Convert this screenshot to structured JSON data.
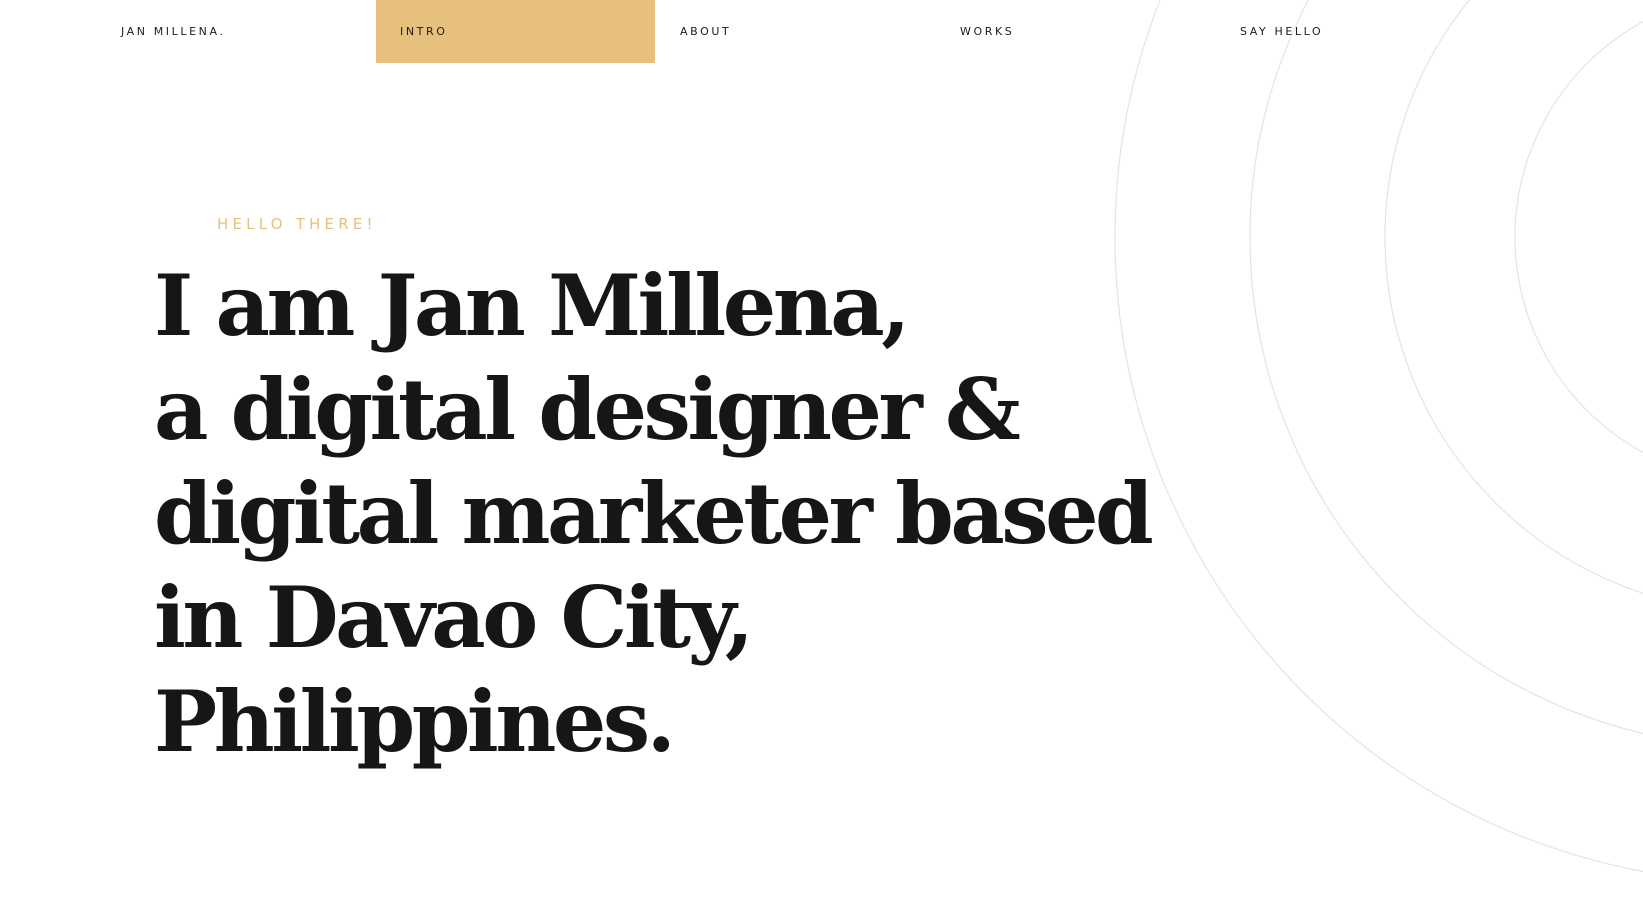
{
  "nav": {
    "brand": "JAN MILLENA.",
    "items": [
      {
        "label": "INTRO",
        "active": true
      },
      {
        "label": "ABOUT",
        "active": false
      },
      {
        "label": "WORKS",
        "active": false
      },
      {
        "label": "SAY HELLO",
        "active": false
      }
    ]
  },
  "hero": {
    "eyebrow": "HELLO THERE!",
    "headline_lines": [
      "I am Jan Millena,",
      "a digital designer &",
      "digital marketer based",
      "in Davao City,",
      "Philippines."
    ]
  },
  "colors": {
    "accent": "#e8c07d",
    "text": "#161616",
    "background": "#ffffff",
    "ring": "#e6e6e6"
  }
}
